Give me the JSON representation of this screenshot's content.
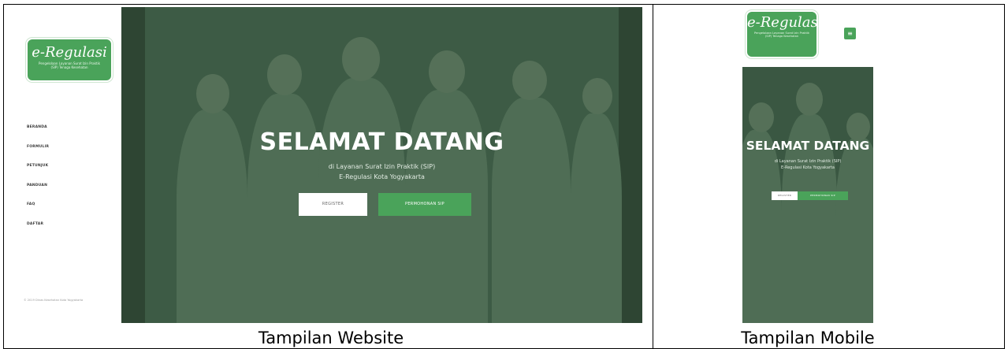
{
  "website": {
    "logo": {
      "title": "e-Regulasi",
      "subtitle": "Pengelolaan Layanan Surat Izin Praktik (SIP) Tenaga Kesehatan"
    },
    "menu": [
      "BERANDA",
      "FORMULIR",
      "PETUNJUK",
      "PANDUAN",
      "FAQ",
      "DAFTAR"
    ],
    "copyright": "© 2019 Dinas Kesehatan Kota Yogyakarta",
    "hero": {
      "title": "SELAMAT DATANG",
      "line1": "di Layanan Surat Izin Praktik (SIP)",
      "line2": "E-Regulasi Kota Yogyakarta",
      "btn_register": "REGISTER",
      "btn_apply": "PERMOHONAN SIP"
    }
  },
  "mobile": {
    "logo": {
      "title": "e-Regulasi",
      "subtitle": "Pengelolaan Layanan Surat Izin Praktik (SIP) Tenaga Kesehatan"
    },
    "menu_icon": "hamburger-icon",
    "hero": {
      "title": "SELAMAT DATANG",
      "line1": "di Layanan Surat Izin Praktik (SIP)",
      "line2": "E-Regulasi Kota Yogyakarta",
      "btn_register": "REGISTER",
      "btn_apply": "PERMOHONAN SIP"
    }
  },
  "captions": {
    "website": "Tampilan Website",
    "mobile": "Tampilan Mobile"
  },
  "colors": {
    "brand_green": "#4aa35a",
    "hero_overlay": "#3d5b45"
  }
}
